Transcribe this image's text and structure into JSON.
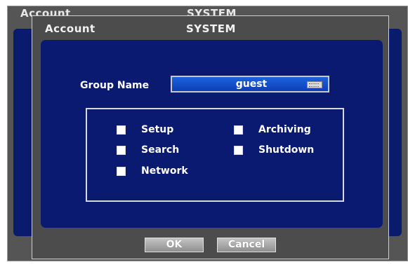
{
  "background_window": {
    "title_left": "Account",
    "title_right": "SYSTEM"
  },
  "dialog": {
    "title_left": "Account",
    "title_right": "SYSTEM",
    "group_name_label": "Group Name",
    "group_name_value": "guest",
    "permissions": [
      {
        "label": "Setup",
        "checked": false
      },
      {
        "label": "Archiving",
        "checked": false
      },
      {
        "label": "Search",
        "checked": false
      },
      {
        "label": "Shutdown",
        "checked": false
      },
      {
        "label": "Network",
        "checked": false
      }
    ],
    "ok_label": "OK",
    "cancel_label": "Cancel"
  },
  "icons": {
    "keyboard": "keyboard-icon"
  },
  "colors": {
    "panel": "#0a1a70",
    "window": "#4c4c4c",
    "input": "#1d62e0"
  }
}
